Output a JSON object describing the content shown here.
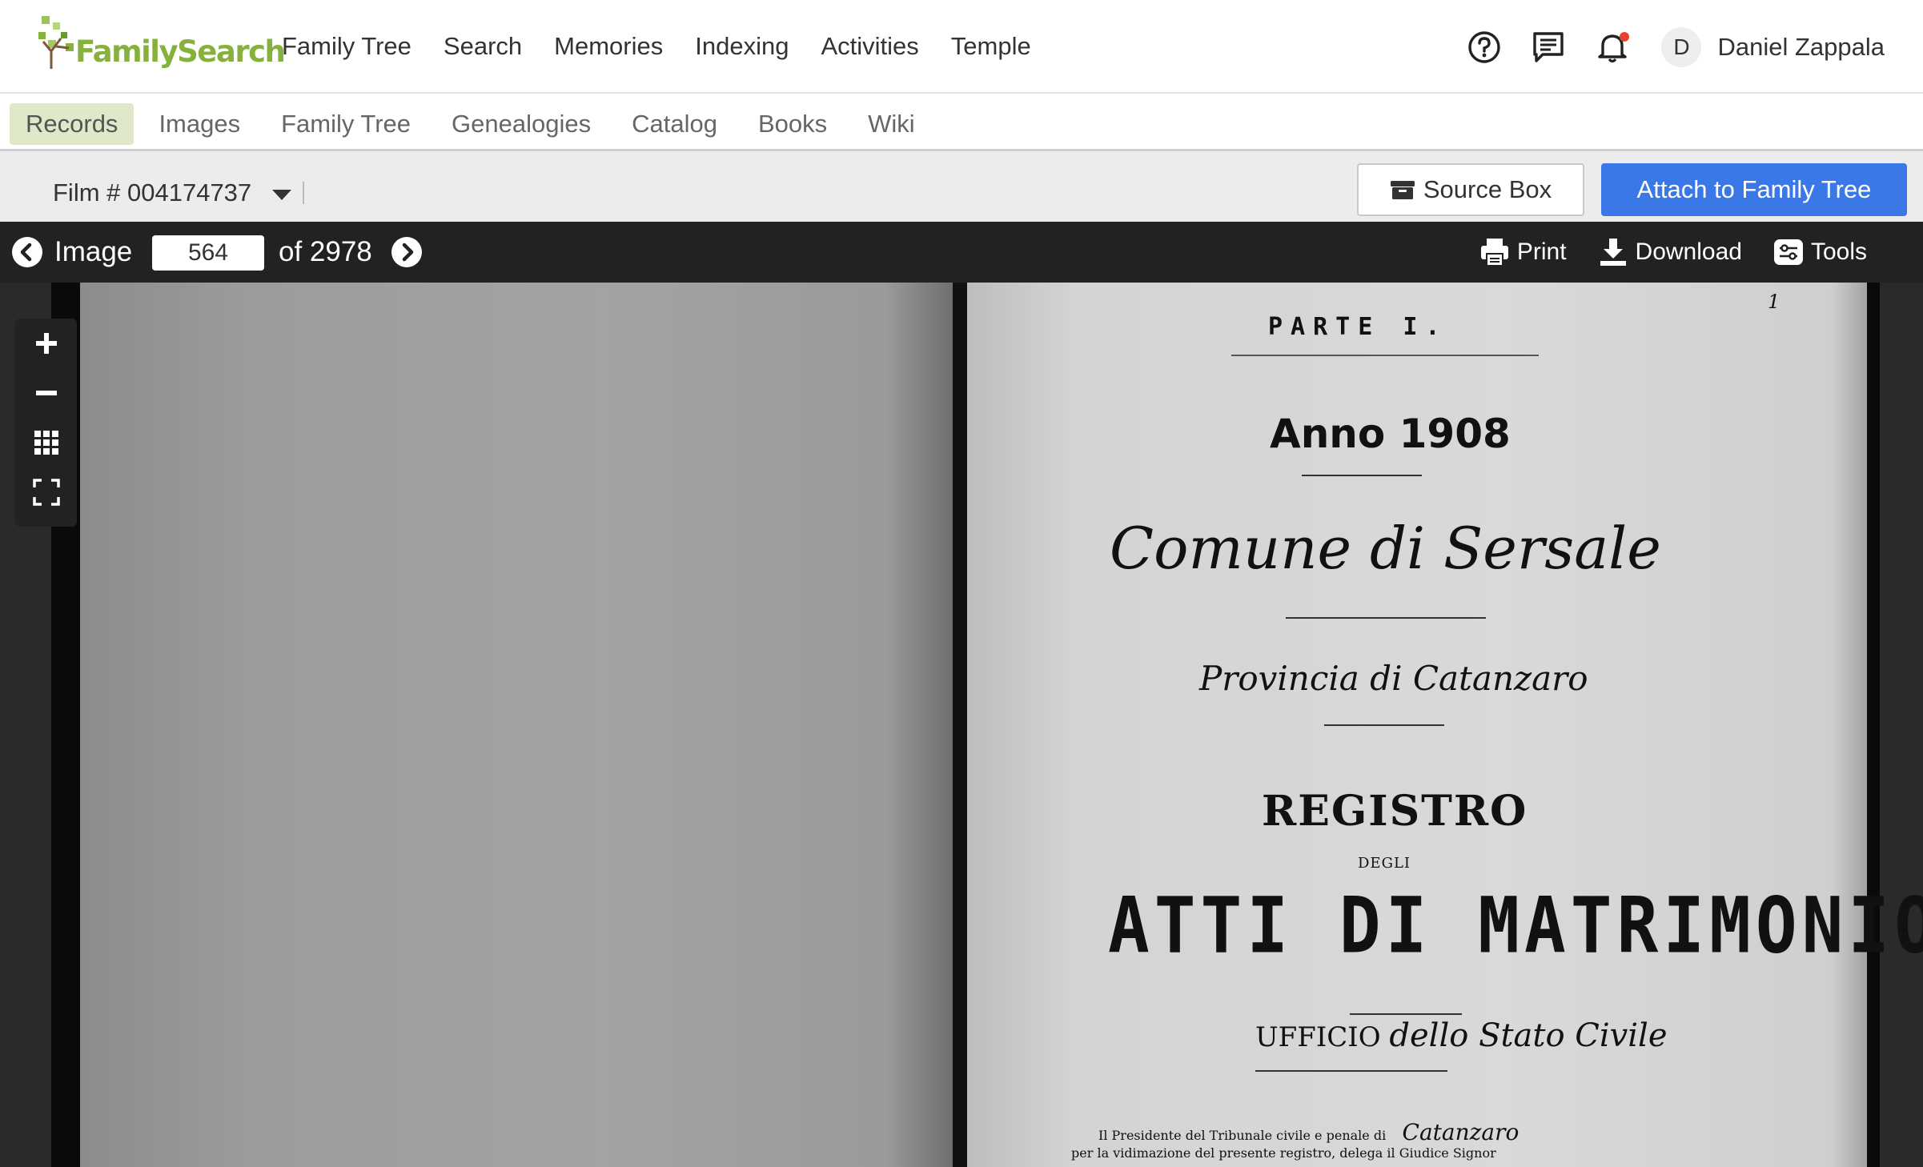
{
  "brand": {
    "name": "FamilySearch"
  },
  "main_nav": [
    "Family Tree",
    "Search",
    "Memories",
    "Indexing",
    "Activities",
    "Temple"
  ],
  "user": {
    "initial": "D",
    "name": "Daniel Zappala"
  },
  "sub_nav": {
    "items": [
      "Records",
      "Images",
      "Family Tree",
      "Genealogies",
      "Catalog",
      "Books",
      "Wiki"
    ],
    "active": "Records"
  },
  "film": {
    "label": "Film # 004174737"
  },
  "actions": {
    "source_box": "Source Box",
    "attach": "Attach to Family Tree"
  },
  "viewer": {
    "image_label": "Image",
    "current_page": "564",
    "total_label": "of 2978",
    "print": "Print",
    "download": "Download",
    "tools": "Tools"
  },
  "document": {
    "corner": "1",
    "parte": "PARTE I.",
    "anno": "Anno 1908",
    "comune": "Comune di Sersale",
    "provincia": "Provincia di Catanzaro",
    "registro": "REGISTRO",
    "degli": "DEGLI",
    "atti": "ATTI DI MATRIMONIO",
    "ufficio": "UFFICIO",
    "ufficio_hand": "dello Stato Civile",
    "line1": "Il Presidente del Tribunale civile e penale di",
    "line1_hand": "Catanzaro",
    "line2": "per la vidimazione del presente registro, delega il Giudice Signor"
  },
  "colors": {
    "brand_green": "#87b13d",
    "primary_blue": "#3b78e7",
    "active_tab": "#dfe8c9",
    "notification": "#e8402e"
  }
}
